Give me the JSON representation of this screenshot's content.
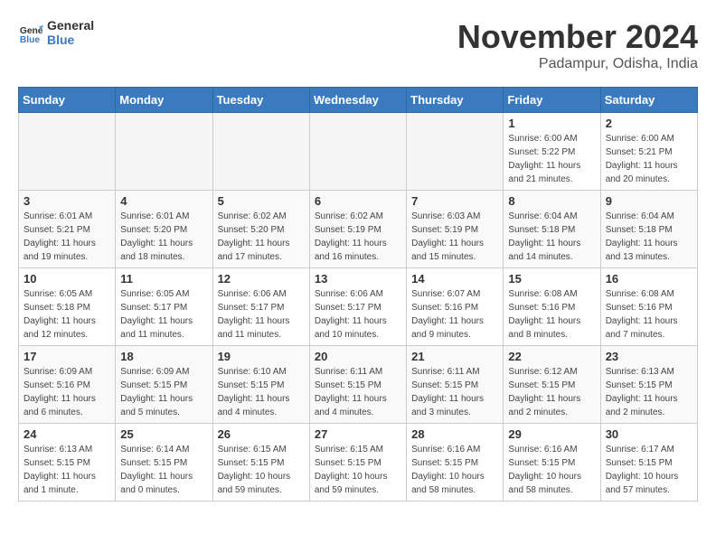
{
  "header": {
    "logo_line1": "General",
    "logo_line2": "Blue",
    "title": "November 2024",
    "subtitle": "Padampur, Odisha, India"
  },
  "weekdays": [
    "Sunday",
    "Monday",
    "Tuesday",
    "Wednesday",
    "Thursday",
    "Friday",
    "Saturday"
  ],
  "weeks": [
    [
      {
        "day": "",
        "info": ""
      },
      {
        "day": "",
        "info": ""
      },
      {
        "day": "",
        "info": ""
      },
      {
        "day": "",
        "info": ""
      },
      {
        "day": "",
        "info": ""
      },
      {
        "day": "1",
        "info": "Sunrise: 6:00 AM\nSunset: 5:22 PM\nDaylight: 11 hours\nand 21 minutes."
      },
      {
        "day": "2",
        "info": "Sunrise: 6:00 AM\nSunset: 5:21 PM\nDaylight: 11 hours\nand 20 minutes."
      }
    ],
    [
      {
        "day": "3",
        "info": "Sunrise: 6:01 AM\nSunset: 5:21 PM\nDaylight: 11 hours\nand 19 minutes."
      },
      {
        "day": "4",
        "info": "Sunrise: 6:01 AM\nSunset: 5:20 PM\nDaylight: 11 hours\nand 18 minutes."
      },
      {
        "day": "5",
        "info": "Sunrise: 6:02 AM\nSunset: 5:20 PM\nDaylight: 11 hours\nand 17 minutes."
      },
      {
        "day": "6",
        "info": "Sunrise: 6:02 AM\nSunset: 5:19 PM\nDaylight: 11 hours\nand 16 minutes."
      },
      {
        "day": "7",
        "info": "Sunrise: 6:03 AM\nSunset: 5:19 PM\nDaylight: 11 hours\nand 15 minutes."
      },
      {
        "day": "8",
        "info": "Sunrise: 6:04 AM\nSunset: 5:18 PM\nDaylight: 11 hours\nand 14 minutes."
      },
      {
        "day": "9",
        "info": "Sunrise: 6:04 AM\nSunset: 5:18 PM\nDaylight: 11 hours\nand 13 minutes."
      }
    ],
    [
      {
        "day": "10",
        "info": "Sunrise: 6:05 AM\nSunset: 5:18 PM\nDaylight: 11 hours\nand 12 minutes."
      },
      {
        "day": "11",
        "info": "Sunrise: 6:05 AM\nSunset: 5:17 PM\nDaylight: 11 hours\nand 11 minutes."
      },
      {
        "day": "12",
        "info": "Sunrise: 6:06 AM\nSunset: 5:17 PM\nDaylight: 11 hours\nand 11 minutes."
      },
      {
        "day": "13",
        "info": "Sunrise: 6:06 AM\nSunset: 5:17 PM\nDaylight: 11 hours\nand 10 minutes."
      },
      {
        "day": "14",
        "info": "Sunrise: 6:07 AM\nSunset: 5:16 PM\nDaylight: 11 hours\nand 9 minutes."
      },
      {
        "day": "15",
        "info": "Sunrise: 6:08 AM\nSunset: 5:16 PM\nDaylight: 11 hours\nand 8 minutes."
      },
      {
        "day": "16",
        "info": "Sunrise: 6:08 AM\nSunset: 5:16 PM\nDaylight: 11 hours\nand 7 minutes."
      }
    ],
    [
      {
        "day": "17",
        "info": "Sunrise: 6:09 AM\nSunset: 5:16 PM\nDaylight: 11 hours\nand 6 minutes."
      },
      {
        "day": "18",
        "info": "Sunrise: 6:09 AM\nSunset: 5:15 PM\nDaylight: 11 hours\nand 5 minutes."
      },
      {
        "day": "19",
        "info": "Sunrise: 6:10 AM\nSunset: 5:15 PM\nDaylight: 11 hours\nand 4 minutes."
      },
      {
        "day": "20",
        "info": "Sunrise: 6:11 AM\nSunset: 5:15 PM\nDaylight: 11 hours\nand 4 minutes."
      },
      {
        "day": "21",
        "info": "Sunrise: 6:11 AM\nSunset: 5:15 PM\nDaylight: 11 hours\nand 3 minutes."
      },
      {
        "day": "22",
        "info": "Sunrise: 6:12 AM\nSunset: 5:15 PM\nDaylight: 11 hours\nand 2 minutes."
      },
      {
        "day": "23",
        "info": "Sunrise: 6:13 AM\nSunset: 5:15 PM\nDaylight: 11 hours\nand 2 minutes."
      }
    ],
    [
      {
        "day": "24",
        "info": "Sunrise: 6:13 AM\nSunset: 5:15 PM\nDaylight: 11 hours\nand 1 minute."
      },
      {
        "day": "25",
        "info": "Sunrise: 6:14 AM\nSunset: 5:15 PM\nDaylight: 11 hours\nand 0 minutes."
      },
      {
        "day": "26",
        "info": "Sunrise: 6:15 AM\nSunset: 5:15 PM\nDaylight: 10 hours\nand 59 minutes."
      },
      {
        "day": "27",
        "info": "Sunrise: 6:15 AM\nSunset: 5:15 PM\nDaylight: 10 hours\nand 59 minutes."
      },
      {
        "day": "28",
        "info": "Sunrise: 6:16 AM\nSunset: 5:15 PM\nDaylight: 10 hours\nand 58 minutes."
      },
      {
        "day": "29",
        "info": "Sunrise: 6:16 AM\nSunset: 5:15 PM\nDaylight: 10 hours\nand 58 minutes."
      },
      {
        "day": "30",
        "info": "Sunrise: 6:17 AM\nSunset: 5:15 PM\nDaylight: 10 hours\nand 57 minutes."
      }
    ]
  ]
}
